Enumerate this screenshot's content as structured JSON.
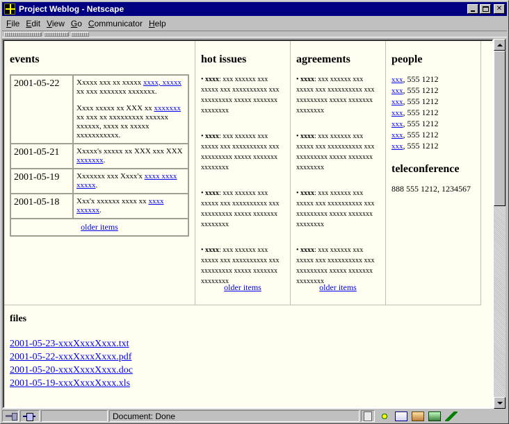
{
  "window": {
    "title": "Project Weblog - Netscape"
  },
  "menu": [
    "File",
    "Edit",
    "View",
    "Go",
    "Communicator",
    "Help"
  ],
  "status": {
    "text": "Document: Done"
  },
  "events": {
    "heading": "events",
    "rows": [
      {
        "date": "2001-05-22",
        "paragraphs": [
          {
            "pre": "Xxxxx xxx xx xxxxx ",
            "link": "xxxx, xxxxx",
            "post": " xx xxx xxxxxxx xxxxxxx."
          },
          {
            "pre": "Xxxx xxxxx xx XXX xx ",
            "link": "xxxxxxx",
            "post": " xx xxx xx xxxxxxxxx xxxxxx xxxxxx, xxxx xx xxxxx xxxxxxxxxxx."
          }
        ]
      },
      {
        "date": "2001-05-21",
        "paragraphs": [
          {
            "pre": "Xxxxx's xxxxx xx XXX xxx XXX ",
            "link": "xxxxxxx",
            "post": "."
          }
        ]
      },
      {
        "date": "2001-05-19",
        "paragraphs": [
          {
            "pre": "Xxxxxxx xxx Xxxx'x ",
            "link": "xxxx xxxx xxxxx",
            "post": "."
          }
        ]
      },
      {
        "date": "2001-05-18",
        "paragraphs": [
          {
            "pre": "Xxx'x xxxxxx xxxx xx ",
            "link": "xxxx xxxxxx",
            "post": "."
          }
        ]
      }
    ],
    "older": "older items"
  },
  "hot_issues": {
    "heading": "hot issues",
    "items": [
      {
        "bullet": "•",
        "key": "xxxx",
        "text": ": xxx xxxxxx xxx xxxxx xxx xxxxxxxxxx xxx xxxxxxxxx xxxxx xxxxxxx xxxxxxxx"
      },
      {
        "bullet": "•",
        "key": "xxxx",
        "text": ": xxx xxxxxx xxx xxxxx xxx xxxxxxxxxx xxx xxxxxxxxx xxxxx xxxxxxx xxxxxxxx"
      },
      {
        "bullet": "•",
        "key": "xxxx",
        "text": ": xxx xxxxxx xxx xxxxx xxx xxxxxxxxxx xxx xxxxxxxxx xxxxx xxxxxxx xxxxxxxx"
      },
      {
        "bullet": "•",
        "key": "xxxx",
        "text": ": xxx xxxxxx xxx xxxxx xxx xxxxxxxxxx xxx xxxxxxxxx xxxxx xxxxxxx xxxxxxxx"
      }
    ],
    "older": "older items"
  },
  "agreements": {
    "heading": "agreements",
    "items": [
      {
        "bullet": "•",
        "key": "xxxx",
        "text": ": xxx xxxxxx xxx xxxxx xxx xxxxxxxxxx xxx xxxxxxxxx xxxxx xxxxxxx xxxxxxxx"
      },
      {
        "bullet": "•",
        "key": "xxxx",
        "text": ": xxx xxxxxx xxx xxxxx xxx xxxxxxxxxx xxx xxxxxxxxx xxxxx xxxxxxx xxxxxxxx"
      },
      {
        "bullet": "•",
        "key": "xxxx",
        "text": ": xxx xxxxxx xxx xxxxx xxx xxxxxxxxxx xxx xxxxxxxxx xxxxx xxxxxxx xxxxxxxx"
      },
      {
        "bullet": "•",
        "key": "xxxx",
        "text": ": xxx xxxxxx xxx xxxxx xxx xxxxxxxxxx xxx xxxxxxxxx xxxxx xxxxxxx xxxxxxxx"
      }
    ],
    "older": "older items"
  },
  "people": {
    "heading": "people",
    "entries": [
      {
        "name": "xxx",
        "phone": ", 555 1212"
      },
      {
        "name": "xxx",
        "phone": ", 555 1212"
      },
      {
        "name": "xxx",
        "phone": ", 555 1212"
      },
      {
        "name": "xxx",
        "phone": ", 555 1212"
      },
      {
        "name": "xxx",
        "phone": ", 555 1212"
      },
      {
        "name": "xxx",
        "phone": ", 555 1212"
      },
      {
        "name": "xxx",
        "phone": ", 555 1212"
      }
    ]
  },
  "teleconference": {
    "heading": "teleconference",
    "text": "888 555 1212, 1234567"
  },
  "files": {
    "heading": "files",
    "items": [
      "2001-05-23-xxxXxxxXxxx.txt",
      "2001-05-22-xxxXxxxXxxx.pdf",
      "2001-05-20-xxxXxxxXxxx.doc",
      "2001-05-19-xxxXxxxXxxx.xls"
    ]
  }
}
